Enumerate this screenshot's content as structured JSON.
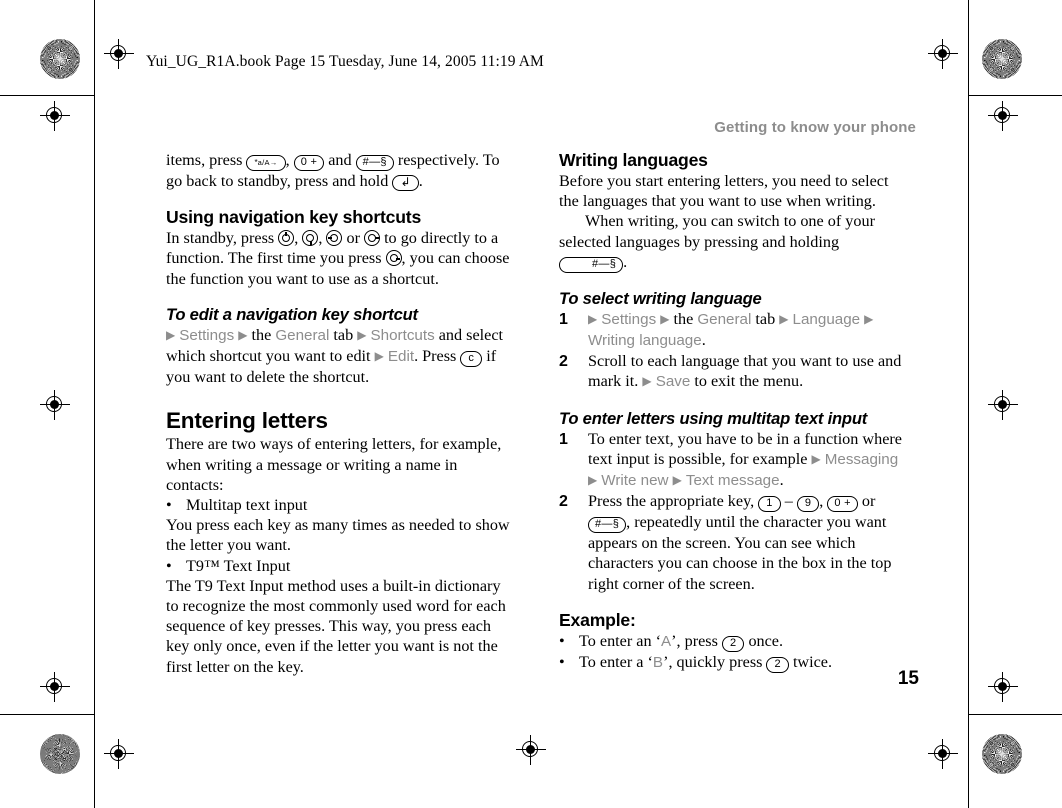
{
  "file_stamp": "Yui_UG_R1A.book  Page 15  Tuesday, June 14, 2005  11:19 AM",
  "running_head": "Getting to know your phone",
  "page_number": "15",
  "colors": {
    "menu_gray": "#8d8d8d",
    "text_black": "#000000",
    "page_background": "#ffffff"
  },
  "keys": {
    "star": "*a/A→",
    "zero": "0 +",
    "hash": "#—§",
    "back": "↶",
    "clear": "c",
    "one": "1",
    "two": "2",
    "nine": "9",
    "dash": "–"
  },
  "left_column": {
    "continued_paragraph": {
      "part1": "items, press ",
      "part2": ", ",
      "part3": " and ",
      "part4": " respectively. To go back to standby, press and hold ",
      "part5": "."
    },
    "section_nav_shortcuts": {
      "heading": "Using navigation key shortcuts",
      "body_1": "In standby, press ",
      "body_2": ", ",
      "body_3": ", ",
      "body_4": " or ",
      "body_5": " to go directly to a function. The first time you press ",
      "body_6": ", you can choose the function you want to use as a shortcut."
    },
    "task_edit_shortcut": {
      "heading": "To edit a navigation key shortcut",
      "m_settings": "Settings",
      "t_the": " the ",
      "m_general": "General",
      "t_tab": " tab ",
      "m_shortcuts": "Shortcuts",
      "t_and_select": " and select which shortcut you want to edit ",
      "m_edit": "Edit",
      "t_press": ". Press ",
      "t_delete": "if you want to delete the shortcut."
    },
    "section_entering_letters": {
      "heading": "Entering letters",
      "intro": "There are two ways of entering letters, for example, when writing a message or writing a name in contacts:",
      "bullet_1": "Multitap text input",
      "after_bullet_1": "You press each key as many times as needed to show the letter you want.",
      "bullet_2": "T9™ Text Input",
      "after_bullet_2": "The T9 Text Input method uses a built-in dictionary to recognize the most commonly used word for each sequence of key presses. This way, you press each key only once, even if the letter you want is not the first letter on the key."
    }
  },
  "right_column": {
    "section_writing_languages": {
      "heading": "Writing languages",
      "para_1": "Before you start entering letters, you need to select the languages that you want to use when writing.",
      "para_2_a": "When writing, you can switch to one of your selected languages by pressing and holding ",
      "para_2_b": "."
    },
    "task_select_language": {
      "heading": "To select writing language",
      "steps": [
        {
          "number": "1",
          "m_settings": "Settings",
          "t_the": " the ",
          "m_general": "General",
          "t_tab": " tab ",
          "m_language": "Language",
          "m_writing_language": "Writing language",
          "t_period": "."
        },
        {
          "number": "2",
          "t_a": "Scroll to each language that you want to use and mark it. ",
          "m_save": "Save",
          "t_b": " to exit the menu."
        }
      ]
    },
    "task_multitap": {
      "heading": "To enter letters using multitap text input",
      "steps": [
        {
          "number": "1",
          "t_a": "To enter text, you have to be in a function where text input is possible, for example ",
          "m_messaging": "Messaging",
          "m_write_new": "Write new",
          "m_text_message": "Text message",
          "t_period": "."
        },
        {
          "number": "2",
          "t_a": "Press the appropriate key, ",
          "t_b": ", repeatedly until the character you want appears on the screen. You can see which characters you can choose in the box in the top right corner of the screen.",
          "t_or": " or "
        }
      ]
    },
    "example": {
      "heading": "Example:",
      "items": [
        {
          "t_a": "To enter an ‘",
          "letter": "A",
          "t_b": "’, press ",
          "t_c": " once."
        },
        {
          "t_a": "To enter a ‘",
          "letter": "B",
          "t_b": "’, quickly press ",
          "t_c": " twice."
        }
      ]
    }
  }
}
